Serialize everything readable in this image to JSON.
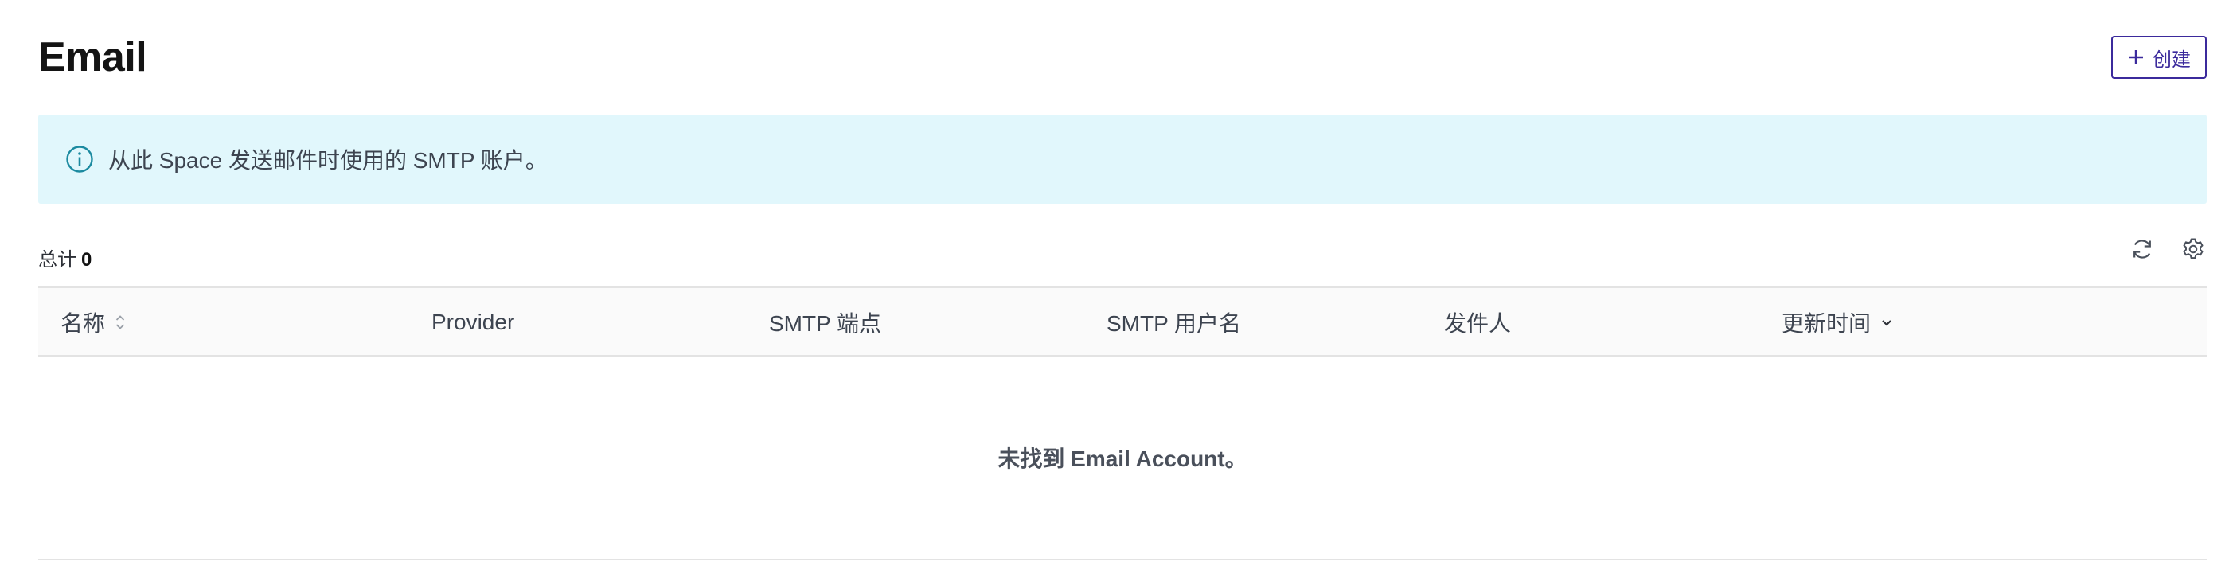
{
  "header": {
    "title": "Email",
    "create_label": "创建"
  },
  "alert": {
    "text": "从此 Space 发送邮件时使用的 SMTP 账户。",
    "icon": "info-icon"
  },
  "toolbar": {
    "total_label": "总计",
    "total_count": "0",
    "icons": [
      "refresh-icon",
      "settings-icon"
    ]
  },
  "table": {
    "columns": [
      {
        "label": "名称",
        "sort": "unsorted"
      },
      {
        "label": "Provider",
        "sort": "none"
      },
      {
        "label": "SMTP 端点",
        "sort": "none"
      },
      {
        "label": "SMTP 用户名",
        "sort": "none"
      },
      {
        "label": "发件人",
        "sort": "none"
      },
      {
        "label": "更新时间",
        "sort": "descending"
      }
    ],
    "rows": [],
    "empty_message": "未找到 Email Account。"
  },
  "colors": {
    "accent": "#3b2a9c",
    "alert_bg": "#e1f7fc",
    "info_icon": "#1b8aa0"
  }
}
